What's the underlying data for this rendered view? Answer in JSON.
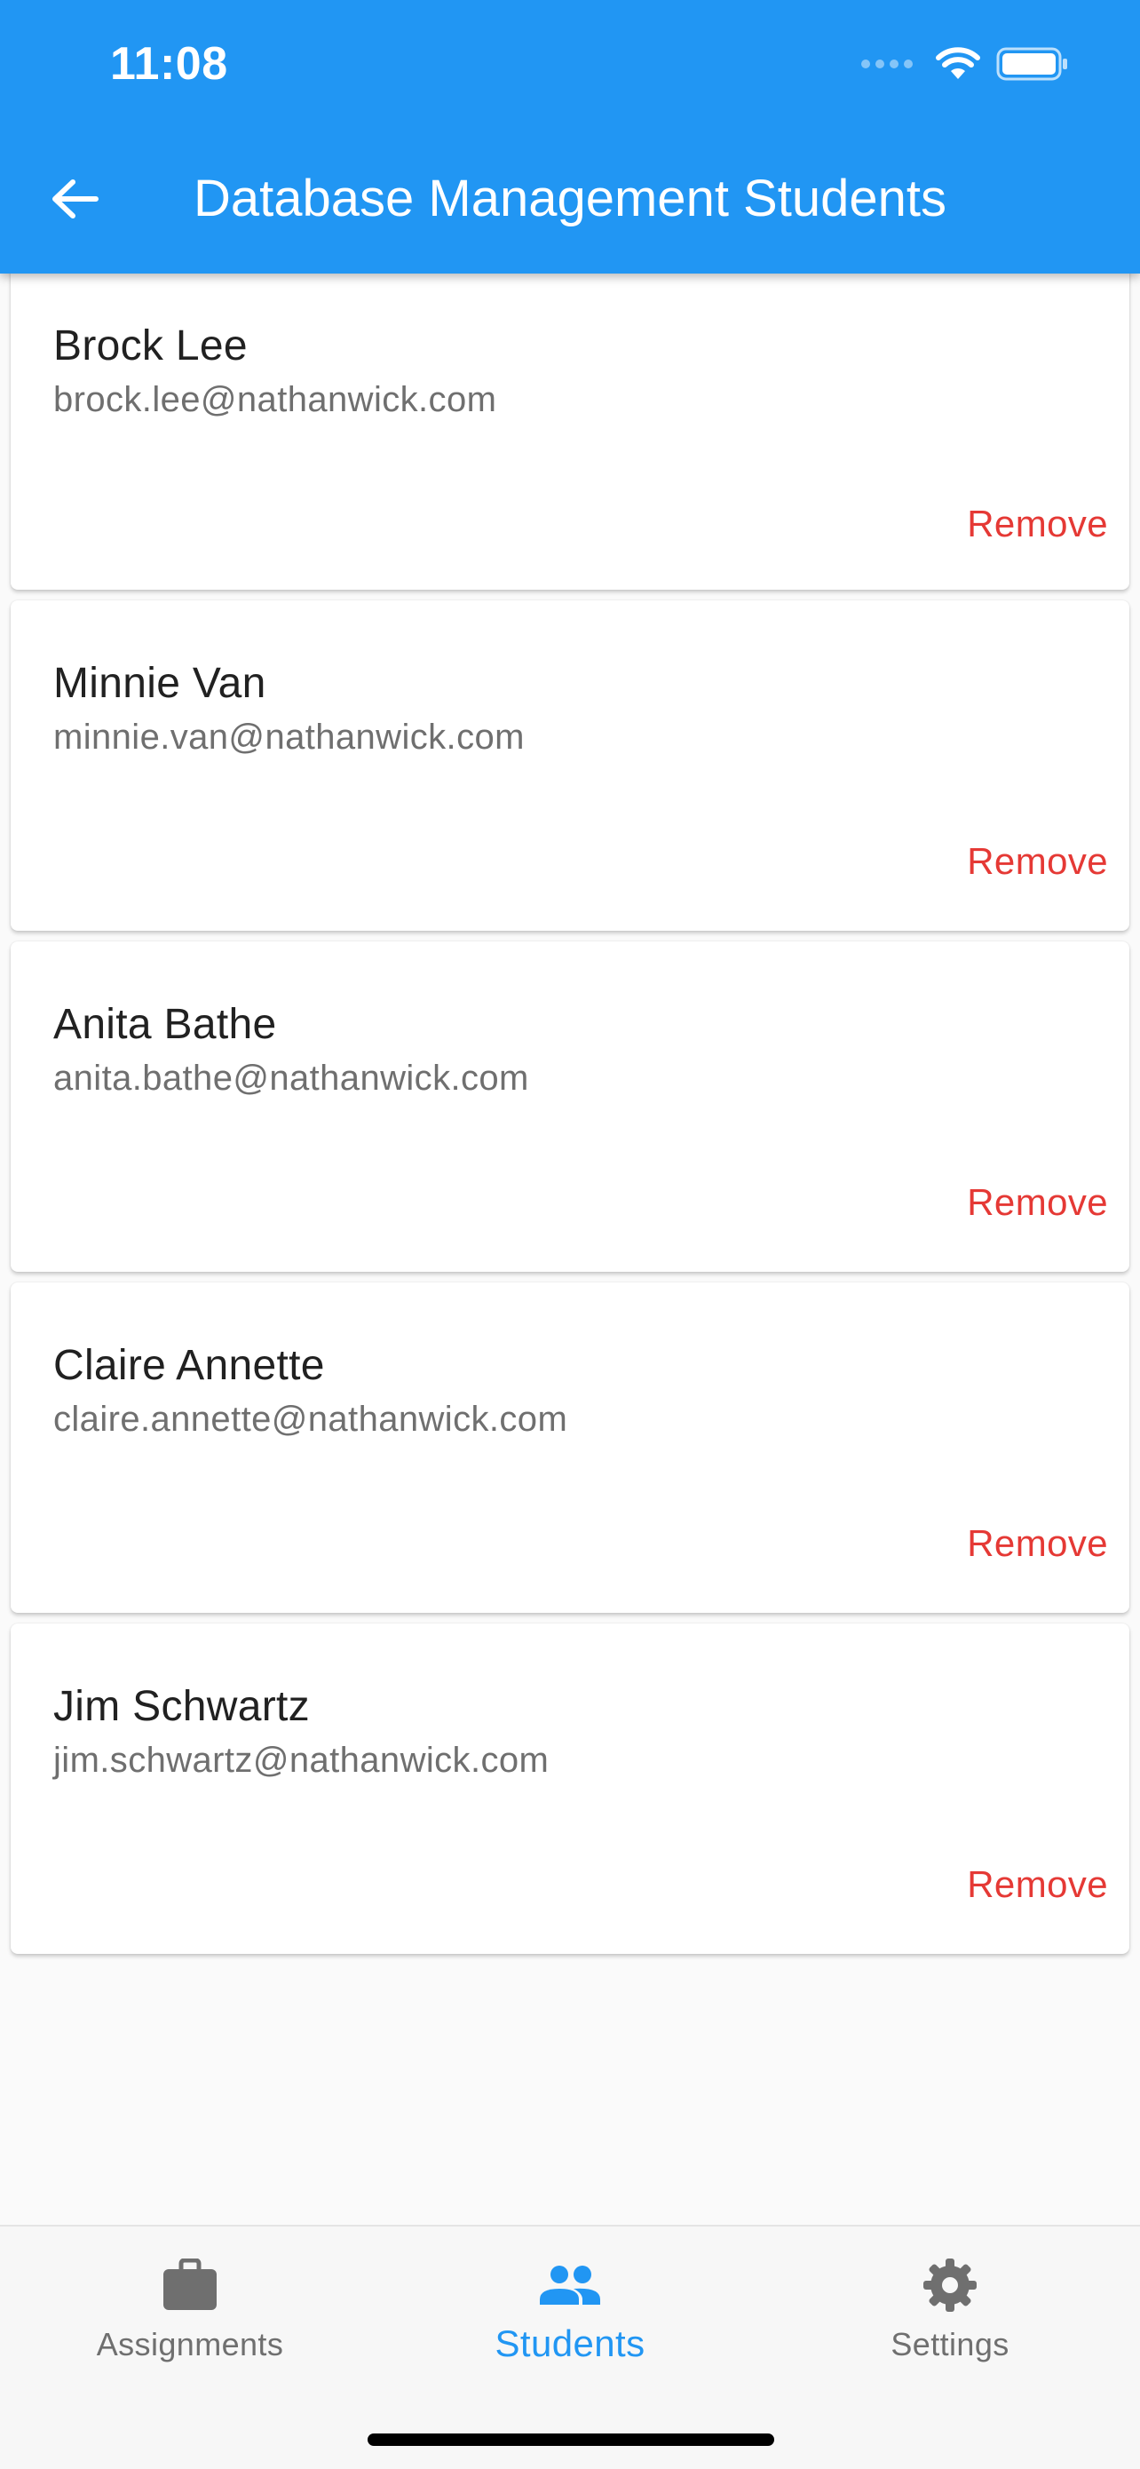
{
  "status_bar": {
    "time": "11:08"
  },
  "app_bar": {
    "title": "Database Management Students",
    "back_icon": "arrow-back-icon"
  },
  "students": [
    {
      "name": "Brock Lee",
      "email": "brock.lee@nathanwick.com",
      "action": "Remove"
    },
    {
      "name": "Minnie Van",
      "email": "minnie.van@nathanwick.com",
      "action": "Remove"
    },
    {
      "name": "Anita Bathe",
      "email": "anita.bathe@nathanwick.com",
      "action": "Remove"
    },
    {
      "name": "Claire Annette",
      "email": "claire.annette@nathanwick.com",
      "action": "Remove"
    },
    {
      "name": "Jim Schwartz",
      "email": "jim.schwartz@nathanwick.com",
      "action": "Remove"
    }
  ],
  "bottom_nav": {
    "items": [
      {
        "label": "Assignments",
        "icon": "briefcase-icon",
        "active": false
      },
      {
        "label": "Students",
        "icon": "people-icon",
        "active": true
      },
      {
        "label": "Settings",
        "icon": "gear-icon",
        "active": false
      }
    ]
  },
  "colors": {
    "primary": "#2196f3",
    "remove": "#e53935",
    "inactive": "#6f6f6f"
  }
}
